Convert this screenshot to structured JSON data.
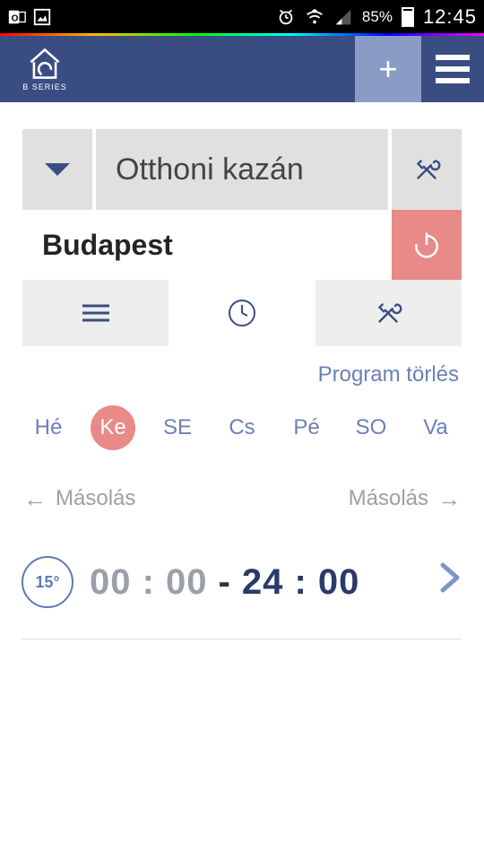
{
  "status": {
    "battery_percent": "85%",
    "time": "12:45"
  },
  "header": {
    "logo_label": "B SERIES"
  },
  "device": {
    "name": "Otthoni kazán"
  },
  "location": {
    "name": "Budapest"
  },
  "actions": {
    "program_delete": "Program törlés",
    "copy_left": "Másolás",
    "copy_right": "Másolás"
  },
  "days": [
    {
      "abbr": "Hé",
      "selected": false
    },
    {
      "abbr": "Ke",
      "selected": true
    },
    {
      "abbr": "SE",
      "selected": false
    },
    {
      "abbr": "Cs",
      "selected": false
    },
    {
      "abbr": "Pé",
      "selected": false
    },
    {
      "abbr": "SO",
      "selected": false
    },
    {
      "abbr": "Va",
      "selected": false
    }
  ],
  "schedule": {
    "temperature": "15°",
    "start": "00 : 00",
    "separator": "-",
    "end": "24 : 00"
  }
}
